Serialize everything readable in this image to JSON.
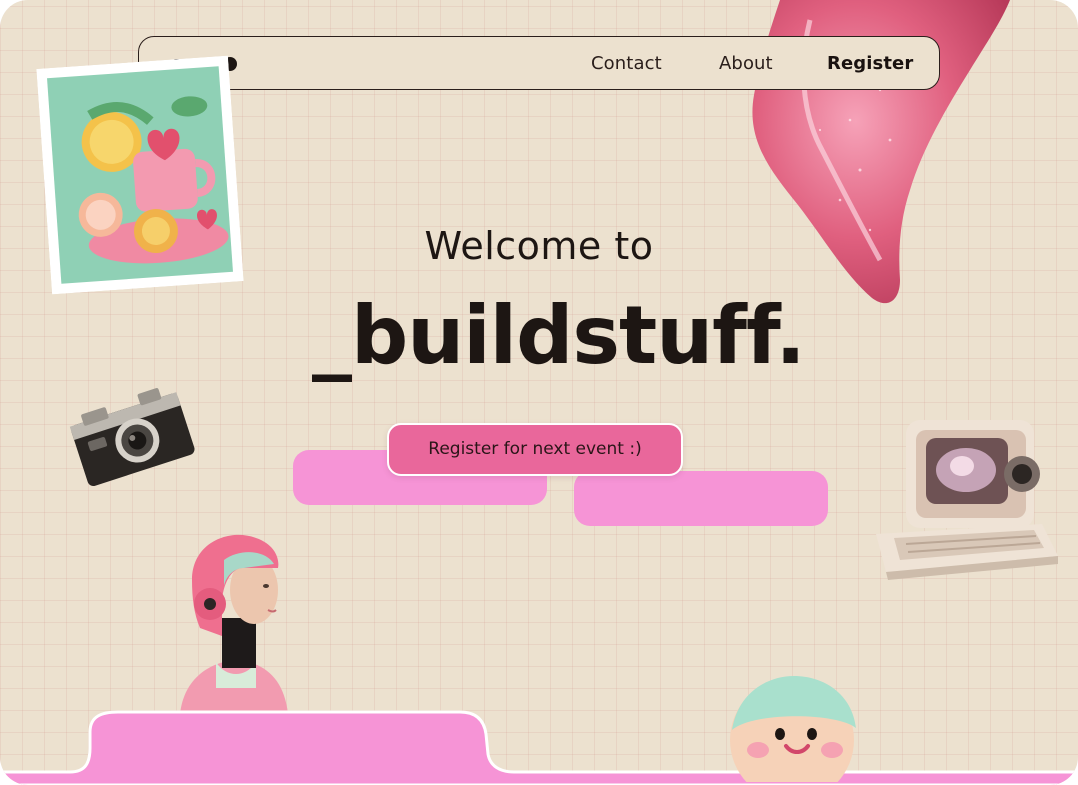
{
  "nav": {
    "links": [
      "Contact",
      "About",
      "Register"
    ]
  },
  "hero": {
    "welcome": "Welcome to",
    "brand": "_buildstuff.",
    "cta": "Register for next event :)"
  },
  "colors": {
    "background": "#ece1cf",
    "ink": "#1d1613",
    "pink_bar": "#f694d6",
    "cta": "#e9679b"
  },
  "icons": [
    "logo-mark",
    "paper-craft-breakfast-photo",
    "lip-gloss-smear",
    "retro-camera",
    "retro-computer",
    "helmet-girl",
    "smiling-face-ball"
  ]
}
